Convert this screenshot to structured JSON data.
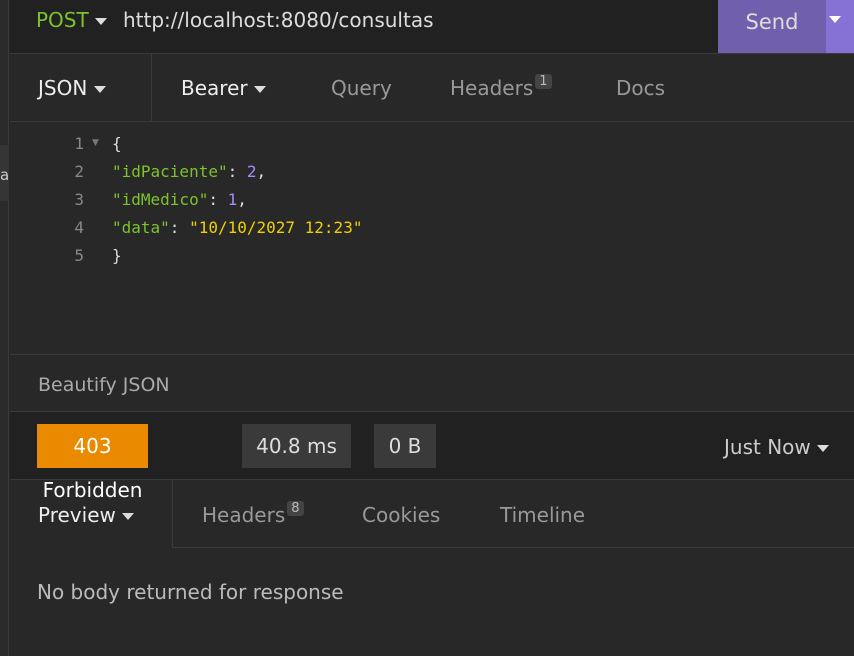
{
  "sidebar": {
    "partial_text": "a"
  },
  "request": {
    "method": "POST",
    "url": "http://localhost:8080/consultas",
    "send_label": "Send"
  },
  "req_tabs": {
    "body": "JSON",
    "auth": "Bearer",
    "query": "Query",
    "headers": "Headers",
    "headers_count": "1",
    "docs": "Docs"
  },
  "editor": {
    "line_numbers": [
      "1",
      "2",
      "3",
      "4",
      "5"
    ],
    "lines": {
      "open": "{",
      "k1": "\"idPaciente\"",
      "v1": "2",
      "k2": "\"idMedico\"",
      "v2": "1",
      "k3": "\"data\"",
      "v3": "\"10/10/2027 12:23\"",
      "close": "}"
    }
  },
  "beautify_label": "Beautify JSON",
  "response": {
    "status": "403 Forbidden",
    "status_color": "#ea8a00",
    "time": "40.8 ms",
    "size": "0 B",
    "history": "Just Now",
    "tabs": {
      "preview": "Preview",
      "headers": "Headers",
      "headers_count": "8",
      "cookies": "Cookies",
      "timeline": "Timeline"
    },
    "empty_message": "No body returned for response"
  },
  "colors": {
    "send": "#6f5fad",
    "method": "#7dc32d"
  }
}
